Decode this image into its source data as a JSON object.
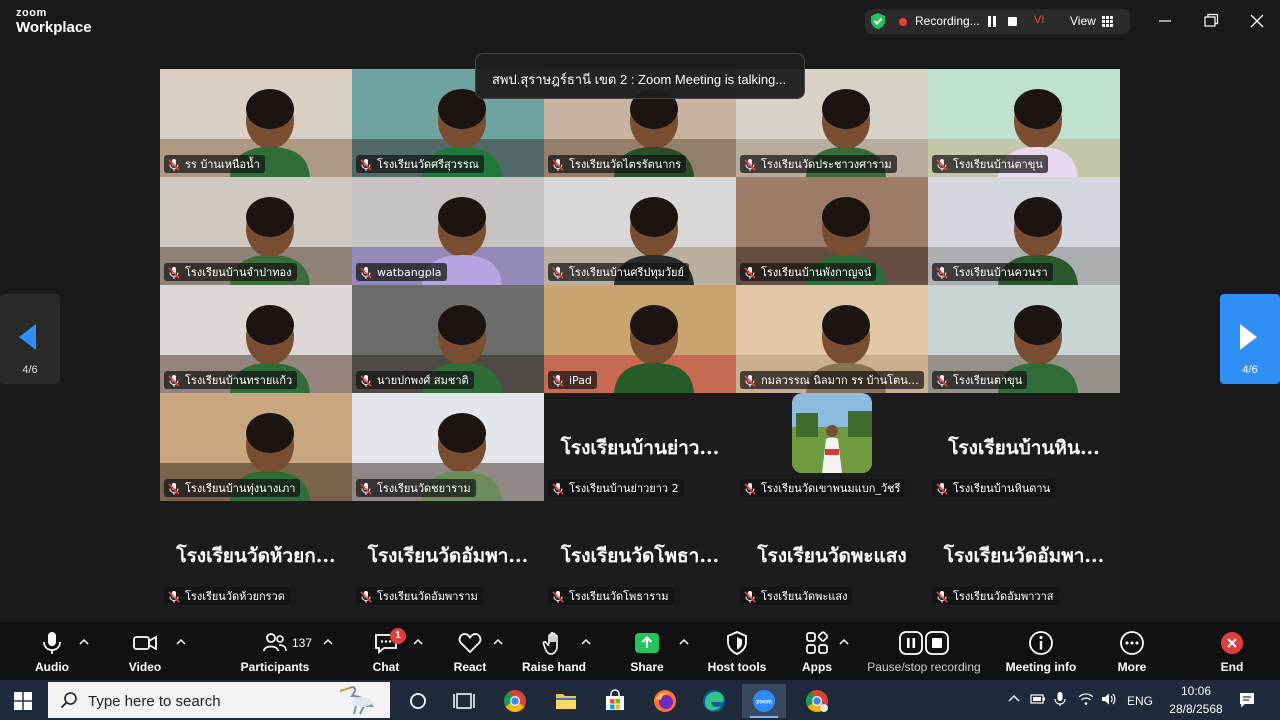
{
  "app": {
    "brand_top": "zoom",
    "brand_bottom": "Workplace"
  },
  "recording": {
    "status_text": "Recording...",
    "user_initials": "VI",
    "view_label": "View"
  },
  "talking_banner": "สพป.สุราษฎร์ธานี เขต 2 : Zoom Meeting is talking...",
  "pager": {
    "left_label": "4/6",
    "right_label": "4/6"
  },
  "tiles": [
    {
      "name": "รร บ้านเหนือน้ำ",
      "kind": "video"
    },
    {
      "name": "โรงเรียนวัดศรีสุวรรณ",
      "kind": "video"
    },
    {
      "name": "โรงเรียนวัดไตรรัตนากร",
      "kind": "video"
    },
    {
      "name": "โรงเรียนวัดประชาวงศาราม",
      "kind": "video"
    },
    {
      "name": "โรงเรียนบ้านตาขุน",
      "kind": "video"
    },
    {
      "name": "โรงเรียนบ้านจำปาทอง",
      "kind": "video"
    },
    {
      "name": "watbangpla",
      "kind": "video"
    },
    {
      "name": "โรงเรียนบ้านศรีปทุมวัยย์",
      "kind": "video"
    },
    {
      "name": "โรงเรียนบ้านพังกาญจน์",
      "kind": "video"
    },
    {
      "name": "โรงเรียนบ้านควนรา",
      "kind": "video"
    },
    {
      "name": "โรงเรียนบ้านทรายแก้ว",
      "kind": "video"
    },
    {
      "name": "นายปกพงศ์ สมชาติ",
      "kind": "video"
    },
    {
      "name": "iPad",
      "kind": "video"
    },
    {
      "name": "กมลวรรณ นิลมาก รร บ้านโตนยาง",
      "kind": "video"
    },
    {
      "name": "โรงเรียนตาขุน",
      "kind": "video"
    },
    {
      "name": "โรงเรียนบ้านทุ่งนางเภา",
      "kind": "video"
    },
    {
      "name": "โรงเรียนวัดชยาราม",
      "kind": "video"
    },
    {
      "name": "โรงเรียนบ้านย่าวยาว 2",
      "kind": "text",
      "big": "โรงเรียนบ้านย่าว..."
    },
    {
      "name": "โรงเรียนวัดเขาพนมแบก_วัชรี",
      "kind": "photo"
    },
    {
      "name": "โรงเรียนบ้านหินดาน",
      "kind": "text",
      "big": "โรงเรียนบ้านหิน..."
    },
    {
      "name": "โรงเรียนวัดห้วยกรวด",
      "kind": "text",
      "big": "โรงเรียนวัดห้วยก..."
    },
    {
      "name": "โรงเรียนวัดอัมพาราม",
      "kind": "text",
      "big": "โรงเรียนวัดอัมพา..."
    },
    {
      "name": "โรงเรียนวัดโพธาราม",
      "kind": "text",
      "big": "โรงเรียนวัดโพธา..."
    },
    {
      "name": "โรงเรียนวัดพะแสง",
      "kind": "text",
      "big": "โรงเรียนวัดพะแสง"
    },
    {
      "name": "โรงเรียนวัดอัมพาวาส",
      "kind": "text",
      "big": "โรงเรียนวัดอัมพา..."
    }
  ],
  "toolbar": {
    "audio": "Audio",
    "video": "Video",
    "participants": "Participants",
    "participants_count": "137",
    "chat": "Chat",
    "chat_badge": "1",
    "react": "React",
    "raise_hand": "Raise hand",
    "share": "Share",
    "host_tools": "Host tools",
    "apps": "Apps",
    "pause_stop": "Pause/stop recording",
    "meeting_info": "Meeting info",
    "more": "More",
    "end": "End"
  },
  "taskbar": {
    "search_placeholder": "Type here to search",
    "language": "ENG",
    "time": "10:06",
    "date": "28/8/2568"
  },
  "colors": {
    "accent": "#2f8ff7",
    "share_green": "#23c45e",
    "end_red": "#e23c3c",
    "record_red": "#f03c3c"
  }
}
